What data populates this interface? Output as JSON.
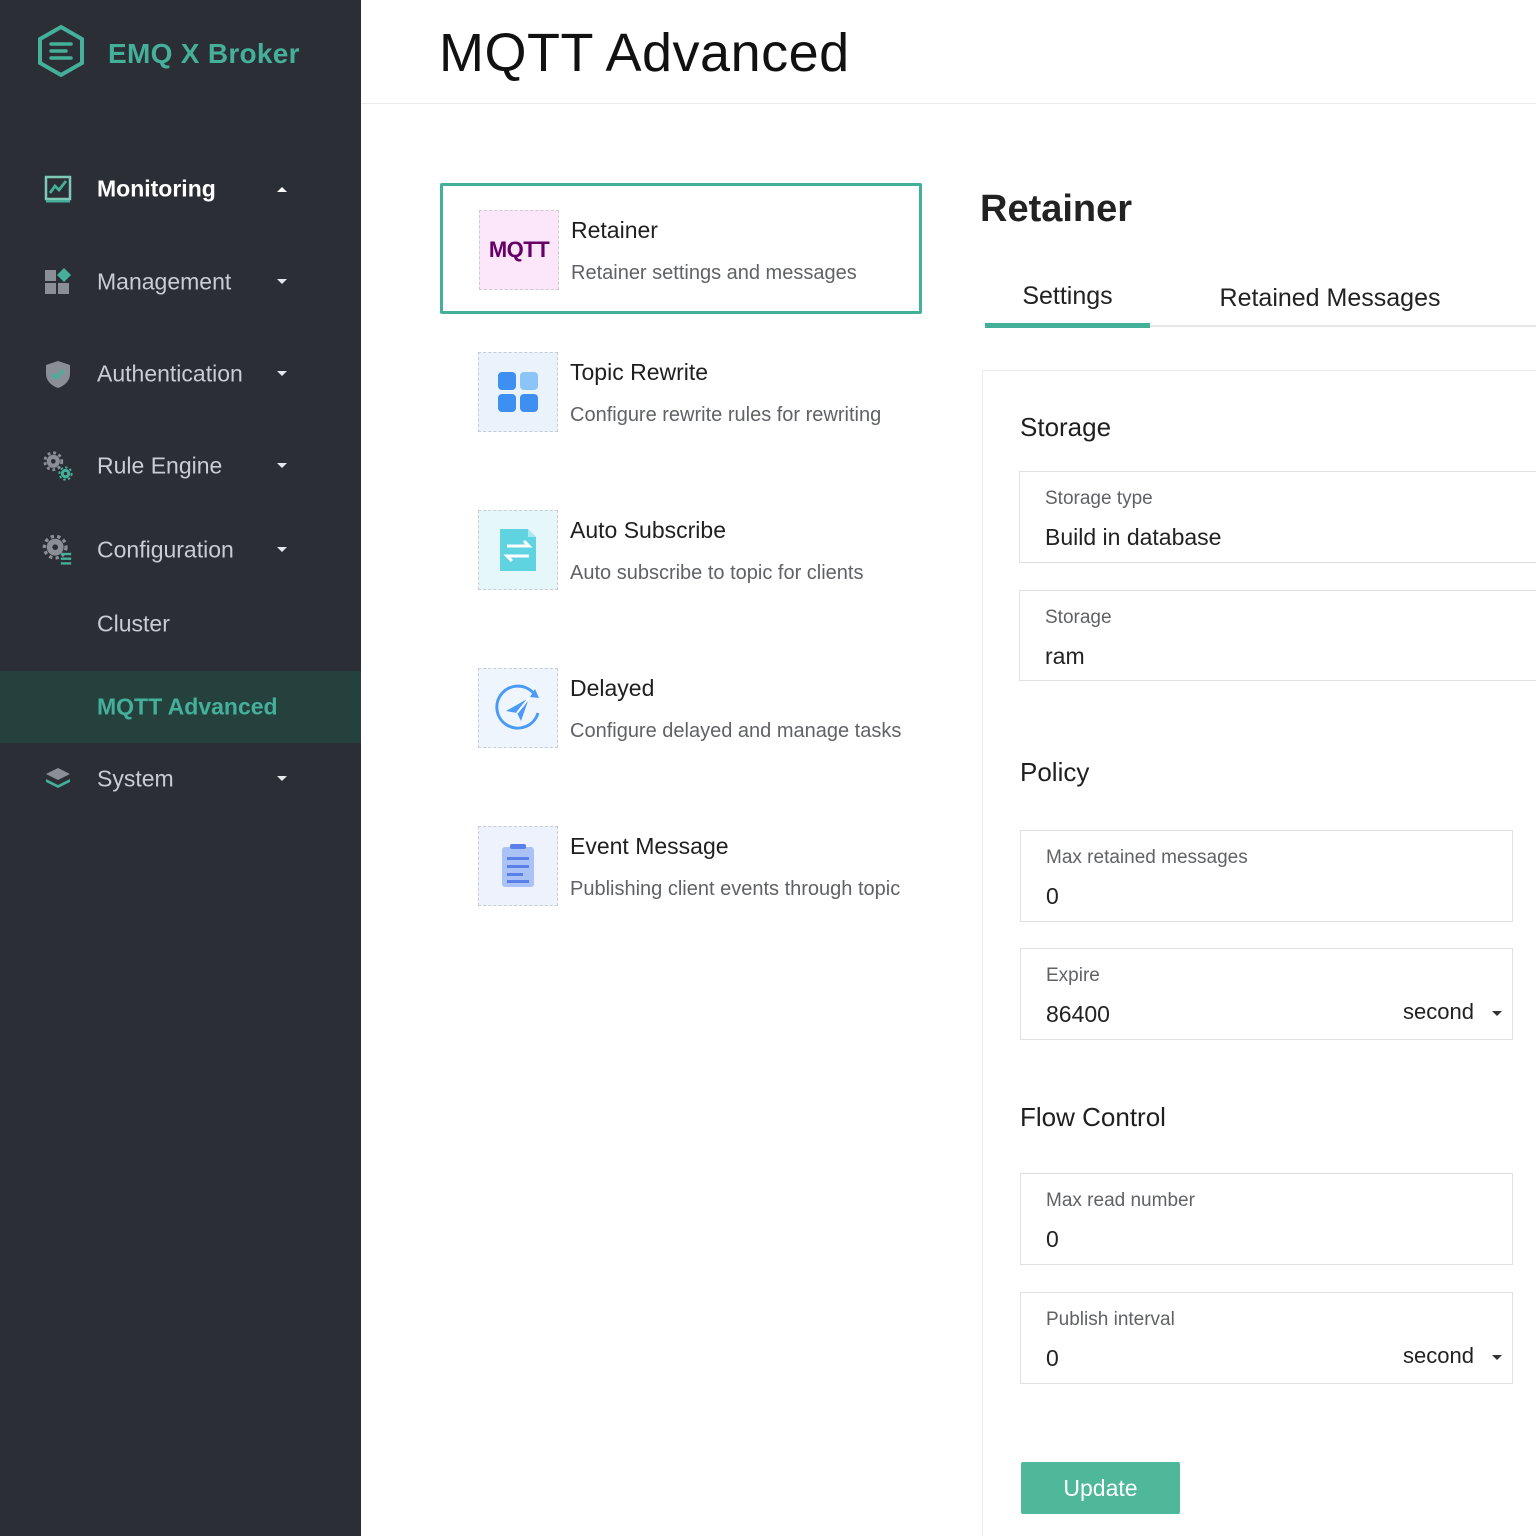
{
  "brand": {
    "title": "EMQ X Broker"
  },
  "sidebar": {
    "items": [
      {
        "label": "Monitoring"
      },
      {
        "label": "Management"
      },
      {
        "label": "Authentication"
      },
      {
        "label": "Rule Engine"
      },
      {
        "label": "Configuration"
      },
      {
        "label": "Cluster"
      },
      {
        "label": "MQTT Advanced"
      },
      {
        "label": "System"
      }
    ]
  },
  "header": {
    "title": "MQTT Advanced"
  },
  "features": [
    {
      "title": "Retainer",
      "desc": "Retainer settings and messages",
      "icon_text": "MQTT"
    },
    {
      "title": "Topic Rewrite",
      "desc": "Configure rewrite rules for rewriting"
    },
    {
      "title": "Auto Subscribe",
      "desc": "Auto subscribe to topic for clients"
    },
    {
      "title": "Delayed",
      "desc": "Configure delayed and manage tasks"
    },
    {
      "title": "Event Message",
      "desc": "Publishing client events through topic"
    }
  ],
  "panel": {
    "title": "Retainer",
    "tabs": [
      {
        "label": "Settings"
      },
      {
        "label": "Retained Messages"
      }
    ],
    "storage": {
      "title": "Storage",
      "storage_type": {
        "label": "Storage type",
        "value": "Build in database"
      },
      "storage": {
        "label": "Storage",
        "value": "ram"
      }
    },
    "policy": {
      "title": "Policy",
      "max_retained": {
        "label": "Max retained messages",
        "value": "0"
      },
      "expire": {
        "label": "Expire",
        "value": "86400",
        "unit": "second"
      }
    },
    "flow_control": {
      "title": "Flow Control",
      "max_read": {
        "label": "Max read number",
        "value": "0"
      },
      "publish_interval": {
        "label": "Publish interval",
        "value": "0",
        "unit": "second"
      }
    },
    "update_label": "Update"
  },
  "colors": {
    "accent": "#45b09a",
    "sidebar_bg": "#2b2e34",
    "active_item_bg": "#24413e",
    "button": "#4fb89a"
  }
}
